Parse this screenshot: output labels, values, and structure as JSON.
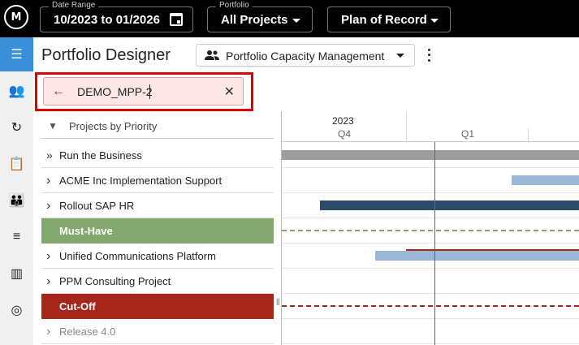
{
  "topbar": {
    "logo": "M",
    "date_range": {
      "legend": "Date Range",
      "value": "10/2023 to 01/2026"
    },
    "portfolio": {
      "legend": "Portfolio",
      "value": "All Projects"
    },
    "scenario": {
      "value": "Plan of Record"
    }
  },
  "sidebar": {
    "items": [
      {
        "icon": "list-indent-icon",
        "glyph": "☰",
        "active": true
      },
      {
        "icon": "people-list-icon",
        "glyph": "👥",
        "active": false
      },
      {
        "icon": "refresh-icon",
        "glyph": "↻",
        "active": false
      },
      {
        "icon": "clipboard-icon",
        "glyph": "📋",
        "active": false
      },
      {
        "icon": "group-icon",
        "glyph": "👪",
        "active": false
      },
      {
        "icon": "list-icon",
        "glyph": "≡",
        "active": false
      },
      {
        "icon": "columns-icon",
        "glyph": "▥",
        "active": false
      },
      {
        "icon": "target-icon",
        "glyph": "◎",
        "active": false
      }
    ]
  },
  "header": {
    "title": "Portfolio Designer",
    "view": "Portfolio Capacity Management"
  },
  "search": {
    "value": "DEMO_MPP-2"
  },
  "tree": {
    "header": "Projects by Priority",
    "rows": [
      {
        "label": "Run the Business",
        "kind": "expand-all"
      },
      {
        "label": "ACME Inc Implementation Support",
        "kind": "item"
      },
      {
        "label": "Rollout SAP HR",
        "kind": "item"
      },
      {
        "label": "Must-Have",
        "kind": "band",
        "color": "#82a86d"
      },
      {
        "label": "Unified Communications Platform",
        "kind": "item"
      },
      {
        "label": "PPM Consulting Project",
        "kind": "item"
      },
      {
        "label": "Cut-Off",
        "kind": "band",
        "color": "#a6261a"
      },
      {
        "label": "Release 4.0",
        "kind": "muted"
      }
    ]
  },
  "timeline": {
    "year": "2023",
    "quarters": [
      "Q4",
      "Q1"
    ]
  },
  "colors": {
    "accent": "#3a8fd9",
    "must_have": "#82a86d",
    "cut_off": "#a6261a",
    "bar_gray": "#9e9e9e",
    "bar_light_blue": "#9bb7d6",
    "bar_dark_blue": "#2d4a6b",
    "today_line": "#d33333"
  }
}
